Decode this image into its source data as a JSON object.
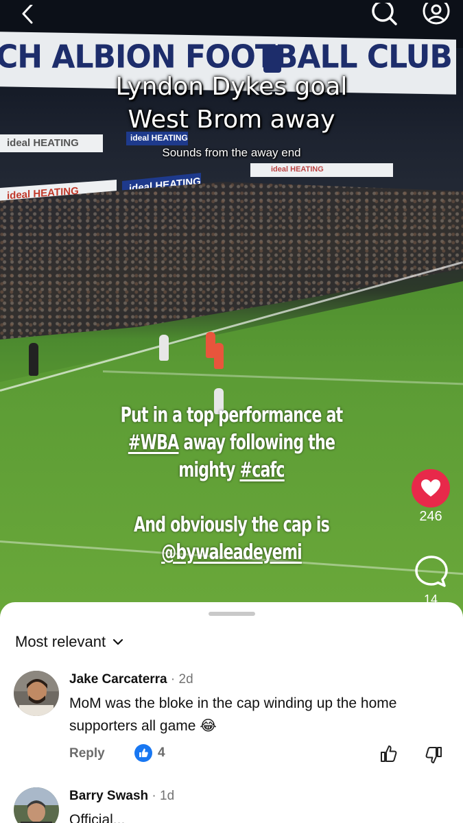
{
  "video": {
    "stadium_banner": "CH ALBION FOOTBALL CLUB",
    "ad_boards": [
      "ideal HEATING",
      "ideal HEATING",
      "ideal HEATING",
      "ideal HEATING",
      "ideal HEATING"
    ],
    "overlay_title_line1": "Lyndon Dykes goal",
    "overlay_title_line2": "West Brom away",
    "overlay_subtitle": "Sounds from the away end",
    "caption": {
      "line1": "Put in a top performance at",
      "line2_tag": "#WBA",
      "line2_rest": " away following the",
      "line3_text": "mighty ",
      "line3_tag": "#cafc",
      "line4": "And obviously the cap is",
      "line5_tag": "@bywaleadeyemi"
    }
  },
  "top_bar": {
    "back_icon": "chevron-left-icon",
    "search_icon": "search-icon",
    "profile_icon": "profile-icon"
  },
  "right_rail": {
    "likes": "246",
    "comments": "14",
    "like_color": "#e8294a"
  },
  "comments_sheet": {
    "sort_label": "Most relevant",
    "comments": [
      {
        "author": "Jake Carcaterra",
        "time": "2d",
        "text": "MoM was the bloke in the cap winding up the home supporters all game 😂",
        "reply_label": "Reply",
        "reaction_count": "4"
      },
      {
        "author": "Barry Swash",
        "time": "1d",
        "text": "Official..."
      }
    ]
  },
  "colors": {
    "accent_blue": "#1877f2",
    "sheet_background": "#ffffff",
    "secondary_text": "#737373"
  }
}
